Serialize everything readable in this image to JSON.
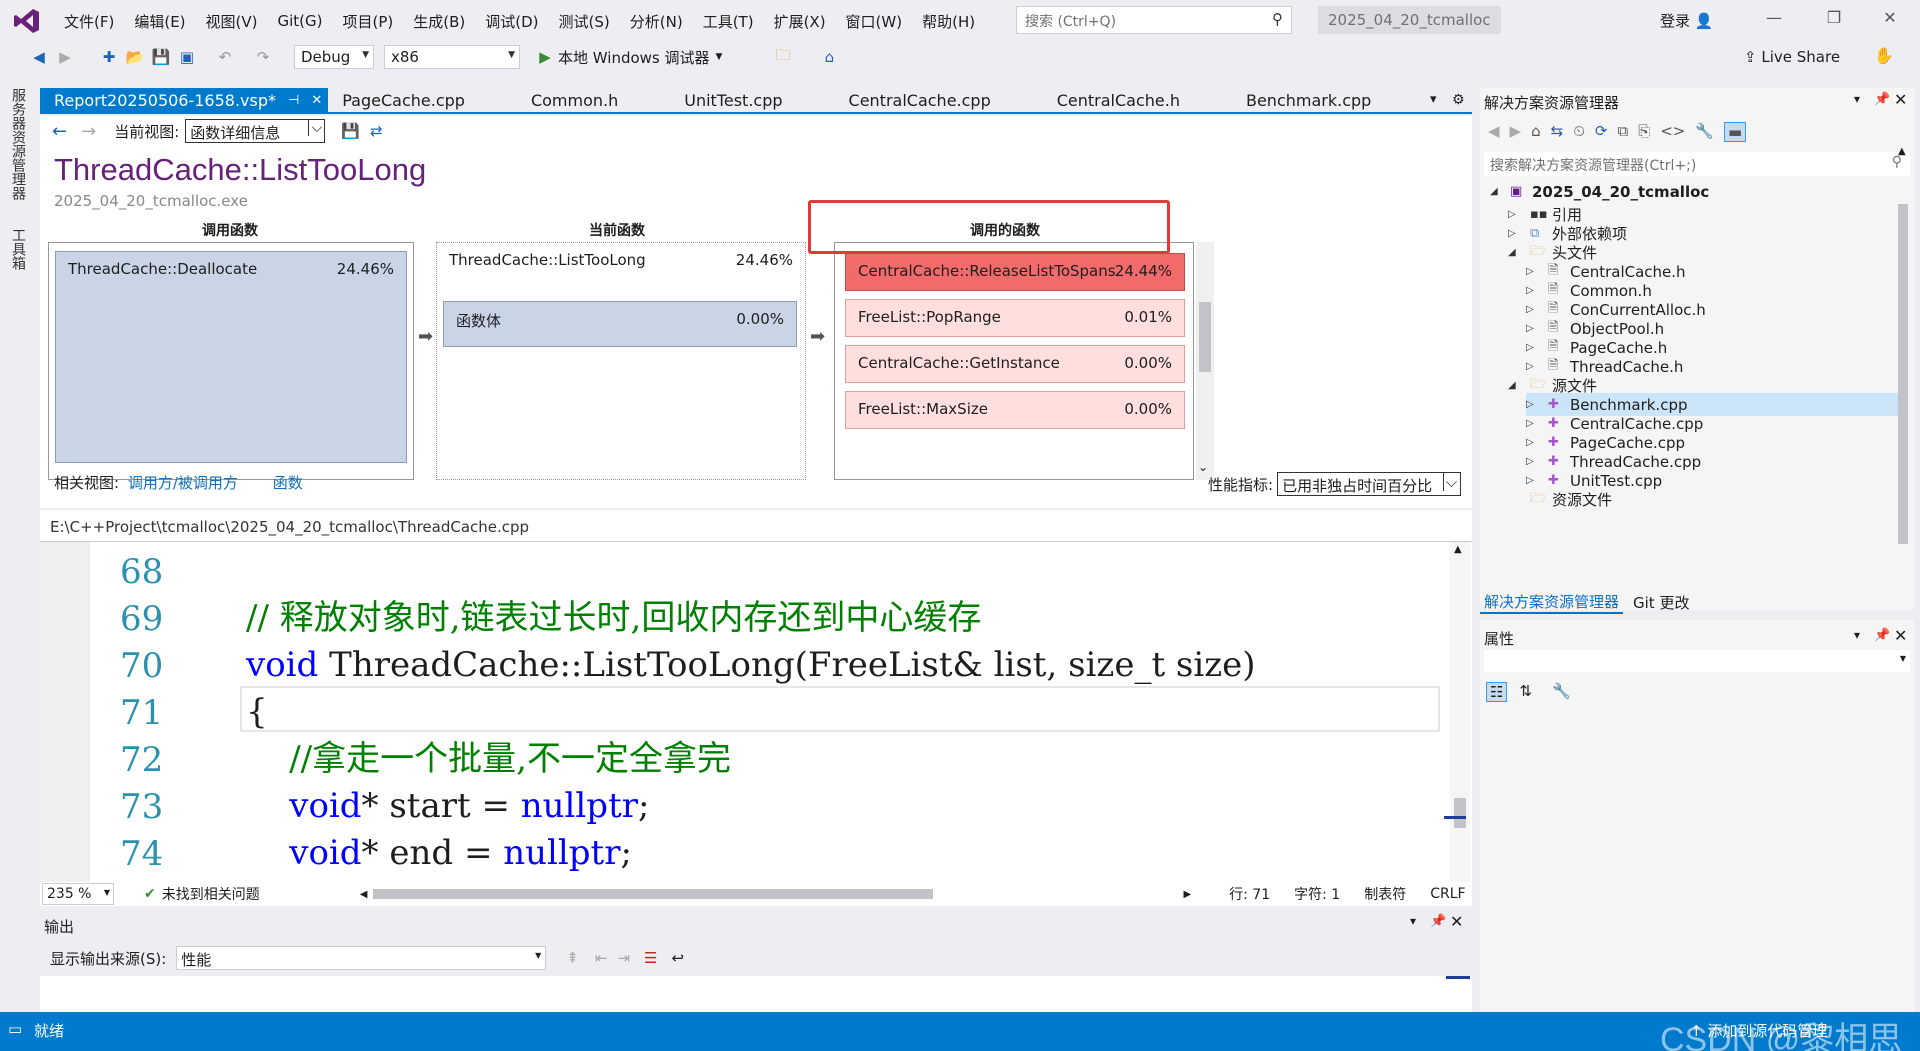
{
  "menubar": {
    "items": [
      "文件(F)",
      "编辑(E)",
      "视图(V)",
      "Git(G)",
      "项目(P)",
      "生成(B)",
      "调试(D)",
      "测试(S)",
      "分析(N)",
      "工具(T)",
      "扩展(X)",
      "窗口(W)",
      "帮助(H)"
    ],
    "search_placeholder": "搜索 (Ctrl+Q)",
    "solution_title": "2025_04_20_tcmalloc",
    "login": "登录"
  },
  "toolbar": {
    "config": "Debug",
    "platform": "x86",
    "debugger": "本地 Windows 调试器",
    "live_share": "Live Share"
  },
  "siderail": {
    "server_explorer": "服务器资源管理器",
    "toolbox": "工具箱"
  },
  "doctabs": [
    "Report20250506-1658.vsp*",
    "PageCache.cpp",
    "Common.h",
    "UnitTest.cpp",
    "CentralCache.cpp",
    "CentralCache.h",
    "Benchmark.cpp"
  ],
  "report": {
    "current_view_label": "当前视图:",
    "current_view": "函数详细信息",
    "function_title": "ThreadCache::ListTooLong",
    "exe": "2025_04_20_tcmalloc.exe",
    "callers_header": "调用函数",
    "current_header": "当前函数",
    "callees_header": "调用的函数",
    "caller": {
      "name": "ThreadCache::Deallocate",
      "pct": "24.46%"
    },
    "current": {
      "name": "ThreadCache::ListTooLong",
      "pct": "24.46%"
    },
    "body": {
      "name": "函数体",
      "pct": "0.00%"
    },
    "callees": [
      {
        "name": "CentralCache::ReleaseListToSpans",
        "pct": "24.44%"
      },
      {
        "name": "FreeList::PopRange",
        "pct": "0.01%"
      },
      {
        "name": "CentralCache::GetInstance",
        "pct": "0.00%"
      },
      {
        "name": "FreeList::MaxSize",
        "pct": "0.00%"
      }
    ],
    "related_label": "相关视图:",
    "related_link1": "调用方/被调用方",
    "related_link2": "函数",
    "metric_label": "性能指标:",
    "metric_value": "已用非独占时间百分比"
  },
  "editor": {
    "path": "E:\\C++Project\\tcmalloc\\2025_04_20_tcmalloc\\ThreadCache.cpp",
    "lines": [
      {
        "num": "68",
        "parts": []
      },
      {
        "num": "69",
        "parts": [
          {
            "cls": "cm",
            "t": "// 释放对象时,链表过长时,回收内存还到中心缓存"
          }
        ]
      },
      {
        "num": "70",
        "parts": [
          {
            "cls": "kw",
            "t": "void"
          },
          {
            "cls": "",
            "t": " ThreadCache::ListTooLong(FreeList& list, size_t size)"
          }
        ]
      },
      {
        "num": "71",
        "parts": [
          {
            "cls": "",
            "t": "{"
          }
        ]
      },
      {
        "num": "72",
        "parts": [
          {
            "cls": "cm",
            "t": "    //拿走一个批量,不一定全拿完"
          }
        ]
      },
      {
        "num": "73",
        "parts": [
          {
            "cls": "kw",
            "t": "    void"
          },
          {
            "cls": "",
            "t": "* start = "
          },
          {
            "cls": "kw",
            "t": "nullptr"
          },
          {
            "cls": "",
            "t": ";"
          }
        ]
      },
      {
        "num": "74",
        "parts": [
          {
            "cls": "kw",
            "t": "    void"
          },
          {
            "cls": "",
            "t": "* end = "
          },
          {
            "cls": "kw",
            "t": "nullptr"
          },
          {
            "cls": "",
            "t": ";"
          }
        ]
      }
    ],
    "zoom": "235 %",
    "issues": "未找到相关问题",
    "row": "行: 71",
    "col": "字符: 1",
    "tabs": "制表符",
    "eol": "CRLF"
  },
  "output": {
    "title": "输出",
    "source_label": "显示输出来源(S):",
    "source_value": "性能"
  },
  "solution_explorer": {
    "title": "解决方案资源管理器",
    "search_placeholder": "搜索解决方案资源管理器(Ctrl+;)",
    "root": "2025_04_20_tcmalloc",
    "items": [
      {
        "label": "引用",
        "level": 1,
        "kind": "ref",
        "tri": "▷"
      },
      {
        "label": "外部依赖项",
        "level": 1,
        "kind": "ext",
        "tri": "▷"
      },
      {
        "label": "头文件",
        "level": 1,
        "kind": "folder",
        "tri": "◢"
      },
      {
        "label": "CentralCache.h",
        "level": 2,
        "kind": "h",
        "tri": "▷"
      },
      {
        "label": "Common.h",
        "level": 2,
        "kind": "h",
        "tri": "▷"
      },
      {
        "label": "ConCurrentAlloc.h",
        "level": 2,
        "kind": "h",
        "tri": "▷"
      },
      {
        "label": "ObjectPool.h",
        "level": 2,
        "kind": "h",
        "tri": "▷"
      },
      {
        "label": "PageCache.h",
        "level": 2,
        "kind": "h",
        "tri": "▷"
      },
      {
        "label": "ThreadCache.h",
        "level": 2,
        "kind": "h",
        "tri": "▷"
      },
      {
        "label": "源文件",
        "level": 1,
        "kind": "folder",
        "tri": "◢"
      },
      {
        "label": "Benchmark.cpp",
        "level": 2,
        "kind": "cpp",
        "tri": "▷"
      },
      {
        "label": "CentralCache.cpp",
        "level": 2,
        "kind": "cpp",
        "tri": "▷"
      },
      {
        "label": "PageCache.cpp",
        "level": 2,
        "kind": "cpp",
        "tri": "▷"
      },
      {
        "label": "ThreadCache.cpp",
        "level": 2,
        "kind": "cpp",
        "tri": "▷"
      },
      {
        "label": "UnitTest.cpp",
        "level": 2,
        "kind": "cpp",
        "tri": "▷"
      },
      {
        "label": "资源文件",
        "level": 1,
        "kind": "folder",
        "tri": ""
      }
    ],
    "tab1": "解决方案资源管理器",
    "tab2": "Git 更改"
  },
  "properties": {
    "title": "属性"
  },
  "statusbar": {
    "ready": "就绪",
    "add_source": "添加到源代码管理",
    "watermark": "CSDN @黎相思"
  },
  "colors": {
    "accent": "#007acc",
    "hot": "#f26b6b",
    "hot_light": "#ffdede",
    "caller_fill": "#c9d4e6",
    "title_purple": "#68217a"
  }
}
